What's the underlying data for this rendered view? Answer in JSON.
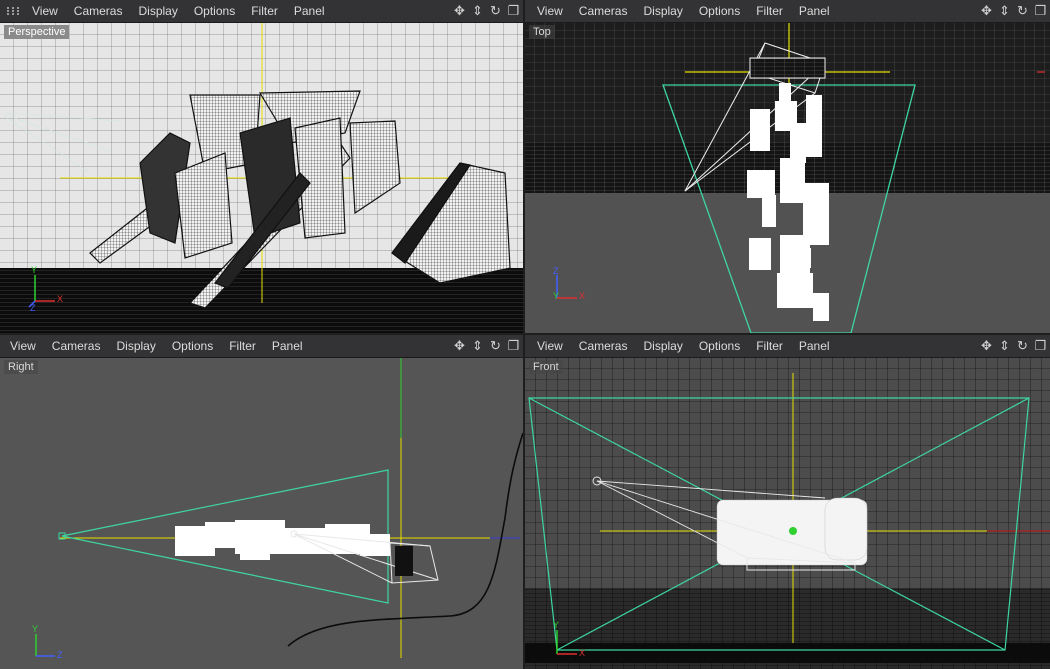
{
  "menu": [
    "View",
    "Cameras",
    "Display",
    "Options",
    "Filter",
    "Panel"
  ],
  "nav_icons": [
    "move-icon",
    "zoom-icon",
    "rotate-icon",
    "maximize-icon"
  ],
  "viewports": [
    {
      "id": "perspective",
      "label": "Perspective"
    },
    {
      "id": "top",
      "label": "Top"
    },
    {
      "id": "right",
      "label": "Right"
    },
    {
      "id": "front",
      "label": "Front"
    }
  ],
  "axes": {
    "perspective": {
      "up": "Y",
      "right": "X",
      "depth": "Z"
    },
    "top": {
      "up": "Z",
      "right": "X",
      "depth": "Y"
    },
    "right": {
      "up": "Y",
      "right": "Z"
    },
    "front": {
      "up": "Y",
      "right": "X"
    }
  },
  "colors": {
    "background": "#2a2a2a",
    "menubar": "#333335",
    "grid_light": "#1a1a1a",
    "axis_yellow": "#e5e000",
    "camera_green": "#3ed6a0",
    "axis_red": "#e03030",
    "axis_green": "#2fd02f",
    "axis_blue": "#4060ff"
  }
}
